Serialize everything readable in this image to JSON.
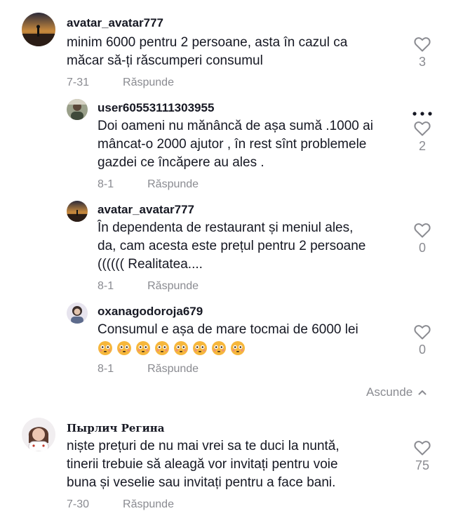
{
  "comments": [
    {
      "username": "avatar_avatar777",
      "lines": [
        "minim 6000 pentru 2 persoane, asta în cazul ca",
        "măcar să-ți răscumperi consumul"
      ],
      "date": "7-31",
      "reply_label": "Răspunde",
      "likes": "3",
      "replies": [
        {
          "username": "user60553111303955",
          "lines": [
            "Doi oameni nu mănâncă de așa sumă .1000 ai",
            "mâncat-o 2000 ajutor , în rest sînt problemele",
            "gazdei ce încăpere au ales ."
          ],
          "date": "8-1",
          "reply_label": "Răspunde",
          "likes": "2"
        },
        {
          "username": "avatar_avatar777",
          "lines": [
            "În dependenta de restaurant și meniul ales,",
            "da, cam acesta este prețul pentru 2 persoane",
            "(((((( Realitatea...."
          ],
          "date": "8-1",
          "reply_label": "Răspunde",
          "likes": "0"
        },
        {
          "username": "oxanagodoroja679",
          "lines": [
            "Consumul e așa de mare tocmai de 6000 lei"
          ],
          "emoji_count": 8,
          "date": "8-1",
          "reply_label": "Răspunde",
          "likes": "0"
        }
      ],
      "collapse_label": "Ascunde"
    },
    {
      "username": "Пырлич Регина",
      "lines": [
        "niște prețuri de nu mai vrei sa te duci la nuntă,",
        "tinerii trebuie să aleagă vor invitați pentru voie",
        "buna și veselie sau invitați pentru a face bani."
      ],
      "date": "7-30",
      "reply_label": "Răspunde",
      "likes": "75"
    }
  ],
  "icons": {
    "like": "heart-outline-icon",
    "more": "more-horizontal-icon",
    "collapse": "chevron-up-icon",
    "emoji": "flushed-face-emoji"
  },
  "colors": {
    "text": "#161823",
    "muted": "#8a8b91",
    "emoji": "#f6b73c"
  }
}
